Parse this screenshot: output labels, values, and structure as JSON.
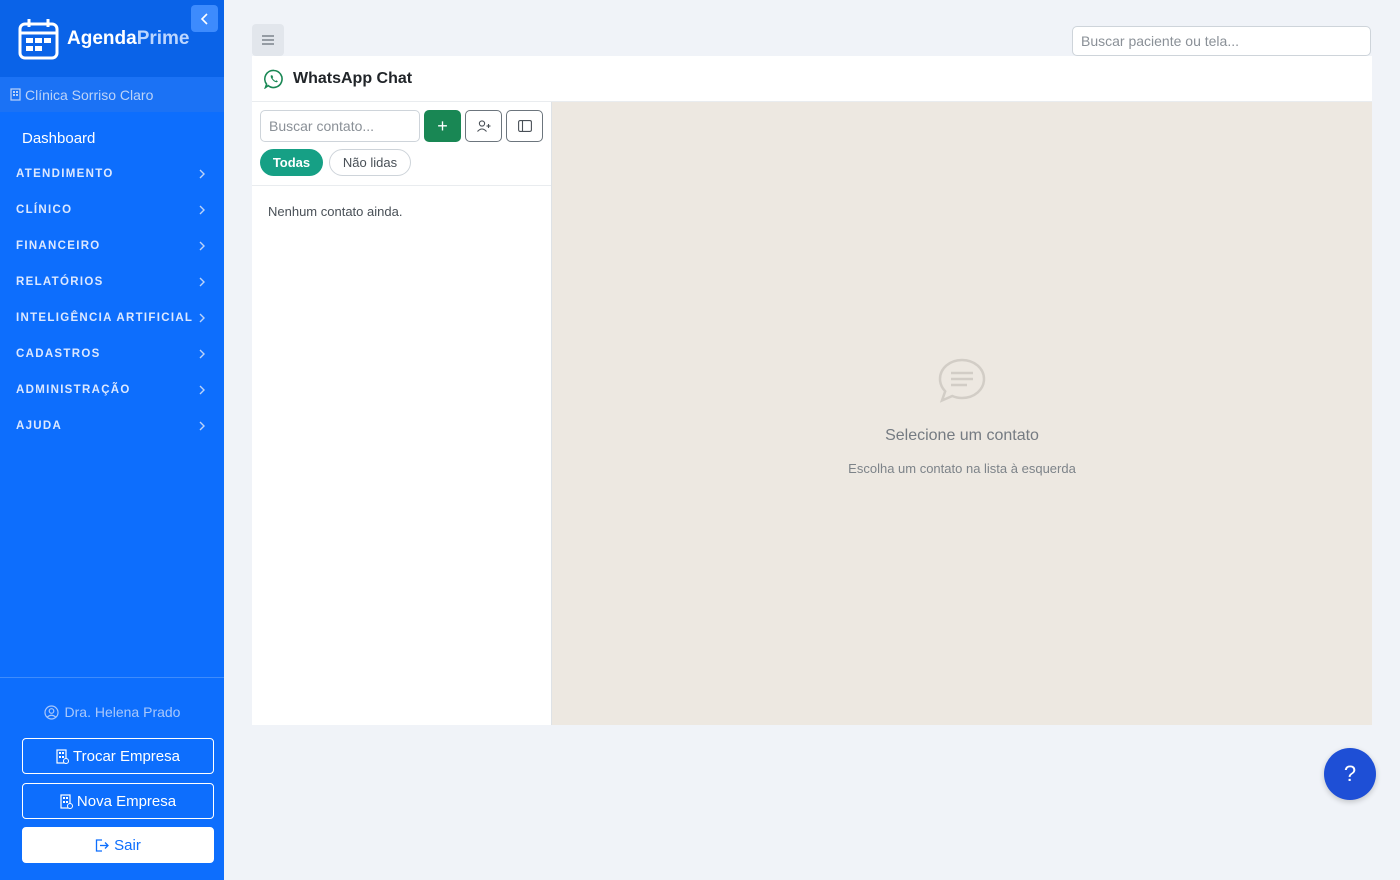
{
  "brand": {
    "name_part1": "Agenda",
    "name_part2": "Prime"
  },
  "sidebar": {
    "clinic": "Clínica Sorriso Claro",
    "dashboard": "Dashboard",
    "sections": [
      {
        "label": "ATENDIMENTO"
      },
      {
        "label": "CLÍNICO"
      },
      {
        "label": "FINANCEIRO"
      },
      {
        "label": "RELATÓRIOS"
      },
      {
        "label": "INTELIGÊNCIA ARTIFICIAL"
      },
      {
        "label": "CADASTROS"
      },
      {
        "label": "ADMINISTRAÇÃO"
      },
      {
        "label": "AJUDA"
      }
    ],
    "user": "Dra. Helena Prado",
    "trocar_empresa": "Trocar Empresa",
    "nova_empresa": "Nova Empresa",
    "sair": "Sair"
  },
  "topbar": {
    "search_placeholder": "Buscar paciente ou tela..."
  },
  "chat": {
    "title": "WhatsApp Chat",
    "contact_search_placeholder": "Buscar contato...",
    "add_label": "+",
    "filters": {
      "all": "Todas",
      "unread": "Não lidas"
    },
    "empty_contacts": "Nenhum contato ainda.",
    "empty_title": "Selecione um contato",
    "empty_subtitle": "Escolha um contato na lista à esquerda"
  },
  "help": {
    "label": "?"
  },
  "colors": {
    "primary": "#0d6efd",
    "success": "#198754",
    "teal": "#16a085",
    "chat_bg": "#ede8e1",
    "help": "#1e4fd6"
  },
  "icons": [
    "calendar-icon",
    "chevron-left-icon",
    "building-icon",
    "chevron-right-icon",
    "user-circle-icon",
    "sign-out-icon",
    "whatsapp-icon",
    "person-add-icon",
    "panel-icon",
    "chat-bubble-icon",
    "hamburger-icon"
  ]
}
